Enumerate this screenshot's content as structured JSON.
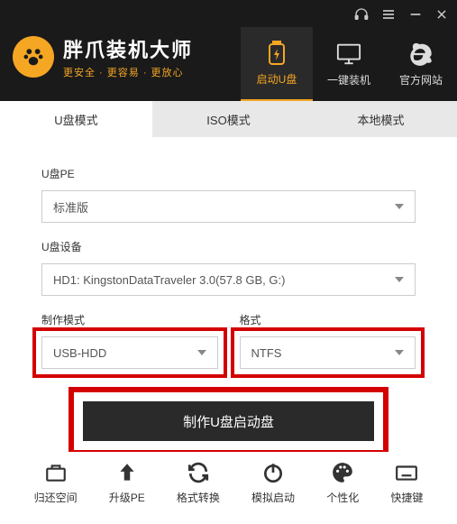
{
  "brand": {
    "title": "胖爪装机大师",
    "subtitle": "更安全 · 更容易 · 更放心"
  },
  "nav": {
    "items": [
      {
        "label": "启动U盘"
      },
      {
        "label": "一键装机"
      },
      {
        "label": "官方网站"
      }
    ]
  },
  "tabs": {
    "items": [
      {
        "label": "U盘模式"
      },
      {
        "label": "ISO模式"
      },
      {
        "label": "本地模式"
      }
    ]
  },
  "form": {
    "pe_label": "U盘PE",
    "pe_value": "标准版",
    "device_label": "U盘设备",
    "device_value": "HD1: KingstonDataTraveler 3.0(57.8 GB, G:)",
    "mode_label": "制作模式",
    "mode_value": "USB-HDD",
    "format_label": "格式",
    "format_value": "NTFS",
    "main_button": "制作U盘启动盘"
  },
  "footer": {
    "items": [
      {
        "label": "归还空间"
      },
      {
        "label": "升级PE"
      },
      {
        "label": "格式转换"
      },
      {
        "label": "模拟启动"
      },
      {
        "label": "个性化"
      },
      {
        "label": "快捷键"
      }
    ]
  }
}
